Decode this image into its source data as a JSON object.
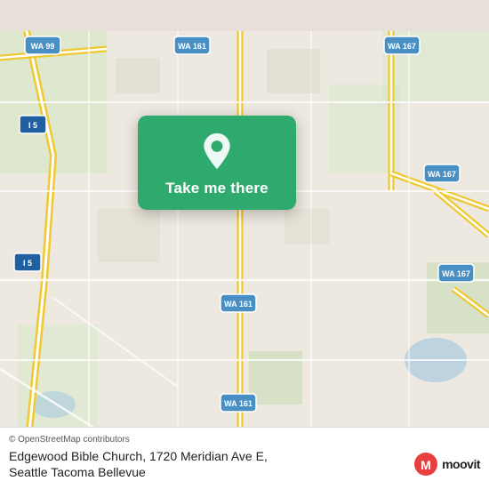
{
  "map": {
    "background_color": "#e8e0d8",
    "road_color": "#ffffff",
    "highway_color": "#f5c842",
    "water_color": "#b0d4e8",
    "park_color": "#c8dfc8"
  },
  "action_card": {
    "background": "#2eaa6f",
    "label": "Take me there",
    "icon": "location-pin"
  },
  "info_bar": {
    "copyright": "© OpenStreetMap contributors",
    "location_name": "Edgewood Bible Church, 1720 Meridian Ave E,",
    "location_city": "Seattle Tacoma Bellevue",
    "moovit_label": "moovit"
  }
}
